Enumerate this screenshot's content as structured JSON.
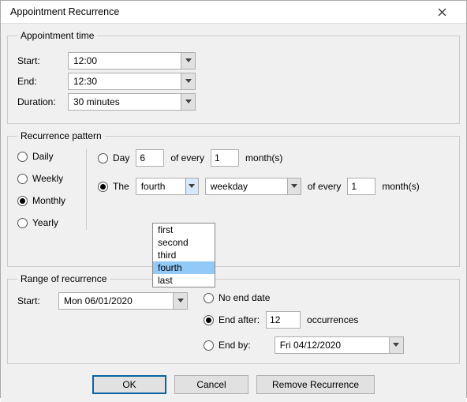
{
  "title": "Appointment Recurrence",
  "groups": {
    "time": "Appointment time",
    "pattern": "Recurrence pattern",
    "range": "Range of recurrence"
  },
  "time": {
    "start_label": "Start:",
    "start_value": "12:00",
    "end_label": "End:",
    "end_value": "12:30",
    "duration_label": "Duration:",
    "duration_value": "30 minutes"
  },
  "freq": {
    "daily": "Daily",
    "weekly": "Weekly",
    "monthly": "Monthly",
    "yearly": "Yearly"
  },
  "monthly": {
    "day_label": "Day",
    "day_value": "6",
    "of_every1": "of every",
    "months1_value": "1",
    "months_suffix": "month(s)",
    "the_label": "The",
    "ordinal_value": "fourth",
    "weekday_value": "weekday",
    "of_every2": "of every",
    "months2_value": "1",
    "ordinal_options": [
      "first",
      "second",
      "third",
      "fourth",
      "last"
    ]
  },
  "range": {
    "start_label": "Start:",
    "start_value": "Mon 06/01/2020",
    "no_end": "No end date",
    "end_after": "End after:",
    "end_after_value": "12",
    "occurrences": "occurrences",
    "end_by": "End by:",
    "end_by_value": "Fri 04/12/2020"
  },
  "buttons": {
    "ok": "OK",
    "cancel": "Cancel",
    "remove": "Remove Recurrence"
  }
}
